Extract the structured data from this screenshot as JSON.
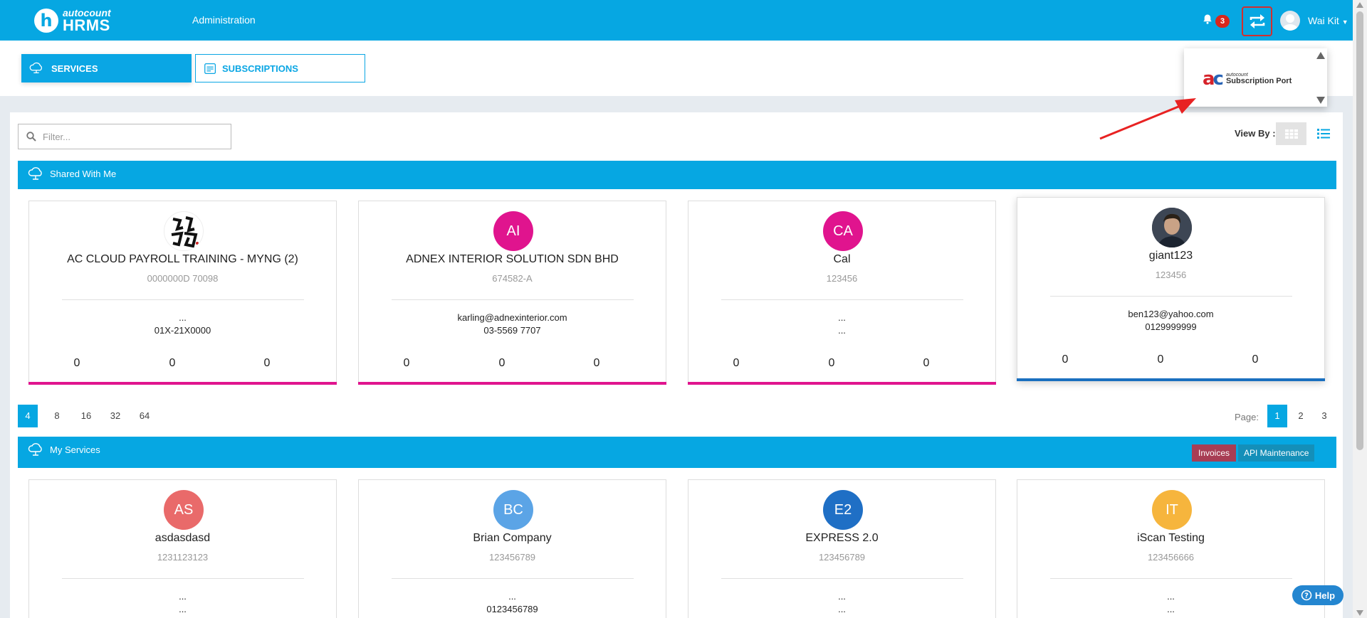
{
  "app": {
    "logo_letter": "h",
    "logo_small": "autocount",
    "logo_big": "HRMS"
  },
  "nav": {
    "admin_label": "Administration",
    "notification_count": "3",
    "user_name": "Wai Kit"
  },
  "tabs": {
    "services_label": "SERVICES",
    "subscriptions_label": "SUBSCRIPTIONS"
  },
  "dropdown": {
    "logo_small": "autocount",
    "logo_big": "Subscription Port"
  },
  "filter": {
    "placeholder": "Filter..."
  },
  "view": {
    "label": "View By :"
  },
  "shared_section": {
    "title": "Shared With Me"
  },
  "my_section": {
    "title": "My Services",
    "invoices_label": "Invoices",
    "api_label": "API Maintenance"
  },
  "colors": {
    "primary": "#06a7e2",
    "pink": "#e0148e",
    "blue": "#1a6fbf"
  },
  "shared_cards": [
    {
      "initials": "",
      "name": "AC CLOUD PAYROLL TRAINING - MYNG (2)",
      "code": "0000000D 70098",
      "line1": "...",
      "line2": "01X-21X0000",
      "c1": "0",
      "c2": "0",
      "c3": "0"
    },
    {
      "initials": "AI",
      "name": "ADNEX INTERIOR SOLUTION SDN BHD",
      "code": "674582-A",
      "line1": "karling@adnexinterior.com",
      "line2": "03-5569 7707",
      "c1": "0",
      "c2": "0",
      "c3": "0"
    },
    {
      "initials": "CA",
      "name": "Cal",
      "code": "123456",
      "line1": "...",
      "line2": "...",
      "c1": "0",
      "c2": "0",
      "c3": "0"
    },
    {
      "initials": "",
      "name": "giant123",
      "code": "123456",
      "line1": "ben123@yahoo.com",
      "line2": "0129999999",
      "c1": "0",
      "c2": "0",
      "c3": "0"
    }
  ],
  "page_sizes": [
    "4",
    "8",
    "16",
    "32",
    "64"
  ],
  "page_label": "Page:",
  "pages": [
    "1",
    "2",
    "3"
  ],
  "my_cards": [
    {
      "initials": "AS",
      "name": "asdasdasd",
      "code": "1231123123",
      "line1": "...",
      "line2": "..."
    },
    {
      "initials": "BC",
      "name": "Brian Company",
      "code": "123456789",
      "line1": "...",
      "line2": "0123456789"
    },
    {
      "initials": "E2",
      "name": "EXPRESS 2.0",
      "code": "123456789",
      "line1": "...",
      "line2": "..."
    },
    {
      "initials": "IT",
      "name": "iScan Testing",
      "code": "123456666",
      "line1": "...",
      "line2": "..."
    }
  ],
  "help_label": "Help"
}
